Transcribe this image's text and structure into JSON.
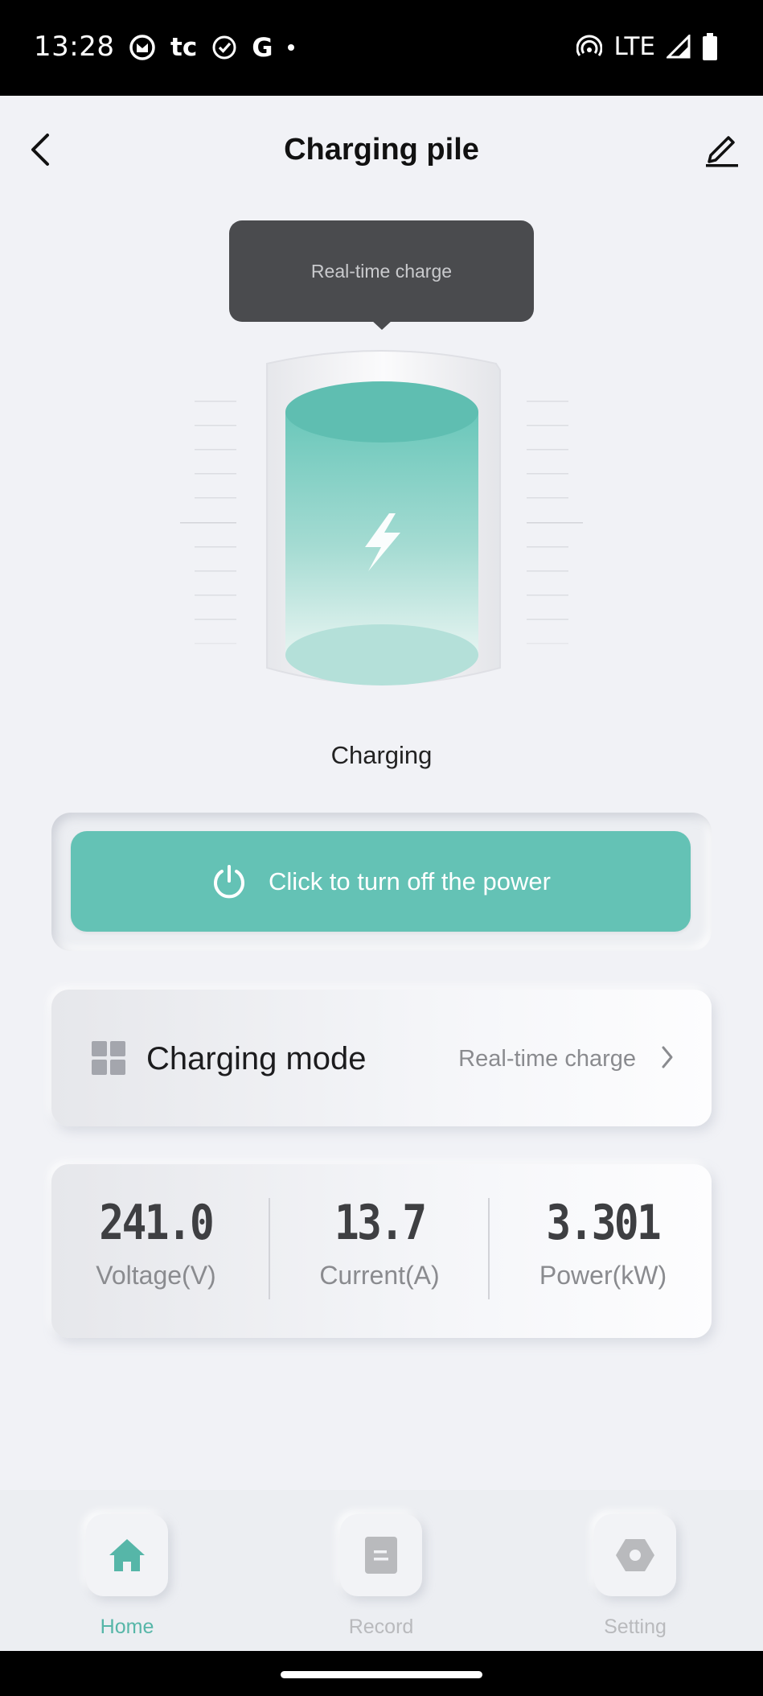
{
  "status_bar": {
    "time": "13:28",
    "network": "LTE",
    "left_icons": [
      "gmail-icon",
      "tc-icon",
      "check-circle-icon",
      "google-icon",
      "dot-icon"
    ],
    "tc_text": "tc",
    "google_text": "G",
    "right_icons": [
      "hotspot-icon",
      "signal-icon",
      "battery-icon"
    ]
  },
  "header": {
    "title": "Charging pile",
    "back_icon": "chevron-left-icon",
    "edit_icon": "pencil-icon"
  },
  "tooltip": {
    "text": "Real-time charge"
  },
  "battery": {
    "icon": "lightning-icon",
    "status": "Charging"
  },
  "power_button": {
    "label": "Click to turn off the power",
    "icon": "power-icon"
  },
  "charging_mode": {
    "label": "Charging mode",
    "value": "Real-time charge",
    "icon": "grid-icon"
  },
  "stats": [
    {
      "value": "241.0",
      "label": "Voltage(V)"
    },
    {
      "value": "13.7",
      "label": "Current(A)"
    },
    {
      "value": "3.301",
      "label": "Power(kW)"
    }
  ],
  "nav": [
    {
      "label": "Home",
      "icon": "home-icon",
      "active": true
    },
    {
      "label": "Record",
      "icon": "document-icon",
      "active": false
    },
    {
      "label": "Setting",
      "icon": "hexagon-settings-icon",
      "active": false
    }
  ],
  "colors": {
    "accent": "#64c2b5",
    "nav_active": "#56b6a8",
    "background": "#f1f2f6",
    "tooltip_bg": "#4a4b4e"
  }
}
